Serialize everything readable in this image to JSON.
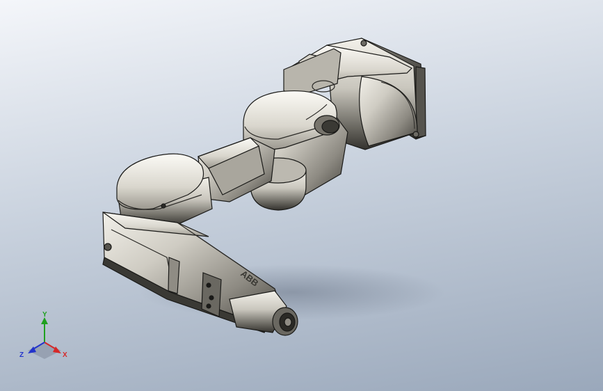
{
  "viewport": {
    "model_logo_text": "ABB",
    "colors": {
      "background_top": "#f4f6fa",
      "background_bottom": "#9aa8bb",
      "body_light": "#efede6",
      "body_mid": "#bdbab1",
      "body_dark": "#4b4943",
      "edge": "#1a1a18"
    }
  },
  "triad": {
    "x_label": "X",
    "y_label": "Y",
    "z_label": "Z",
    "x_color": "#d62828",
    "y_color": "#1fa01f",
    "z_color": "#2233cc"
  }
}
